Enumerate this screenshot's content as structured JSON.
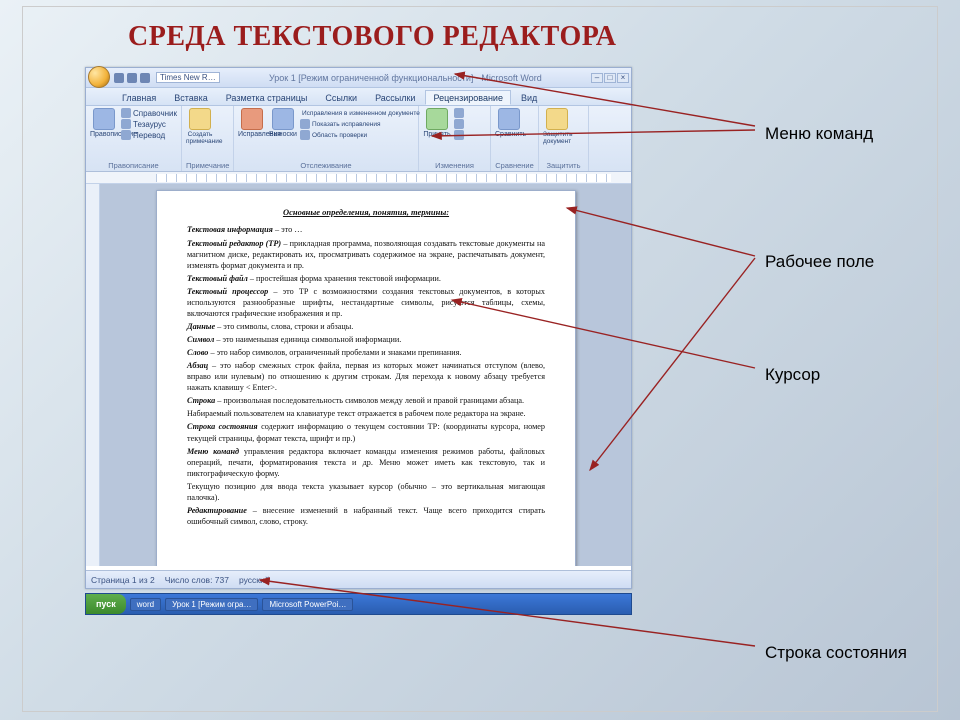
{
  "slide_title": "СРЕДА ТЕКСТОВОГО РЕДАКТОРА",
  "callouts": {
    "menu": "Меню команд",
    "workarea": "Рабочее поле",
    "cursor": "Курсор",
    "statusbar": "Строка состояния"
  },
  "word": {
    "qat_font": "Times New R…",
    "doc_title": "Урок 1 [Режим ограниченной функциональности] - Microsoft Word",
    "tabs": [
      "Главная",
      "Вставка",
      "Разметка страницы",
      "Ссылки",
      "Рассылки",
      "Рецензирование",
      "Вид"
    ],
    "active_tab_index": 5,
    "ribbon_groups": [
      {
        "label": "Правописание",
        "items": [
          "Правописание",
          "Справочник",
          "Тезаурус",
          "Перевод"
        ]
      },
      {
        "label": "Примечание",
        "items": [
          "Создать примечание"
        ]
      },
      {
        "label": "Отслеживание",
        "items": [
          "Исправления",
          "Выноски",
          "Исправления в измененном документе",
          "Показать исправления",
          "Область проверки"
        ]
      },
      {
        "label": "Изменения",
        "items": [
          "Принять",
          "Отклонить"
        ]
      },
      {
        "label": "Сравнение",
        "items": [
          "Сравнить"
        ]
      },
      {
        "label": "Защитить",
        "items": [
          "Защитить документ"
        ]
      }
    ],
    "page": {
      "heading": "Основные определения, понятия, термины:",
      "paragraphs": [
        {
          "b": "Текстовая информация",
          "rest": " – это …"
        },
        {
          "b": "Текстовый редактор (ТР)",
          "rest": " – прикладная программа, позволяющая создавать текстовые документы на магнитном диске, редактировать их, просматривать содержимое на экране, распечатывать документ, изменять формат документа и пр."
        },
        {
          "b": "Текстовый файл",
          "rest": " – простейшая форма хранения текстовой информации."
        },
        {
          "b": "Текстовый процессор",
          "rest": " – это ТР с возможностями создания текстовых документов, в которых используются разнообразные шрифты, нестандартные символы, рисуются таблицы, схемы, включаются графические изображения и пр."
        },
        {
          "b": "Данные",
          "rest": " – это символы, слова, строки и абзацы."
        },
        {
          "b": "Символ",
          "rest": " – это наименьшая единица символьной информации."
        },
        {
          "b": "Слово",
          "rest": " – это набор символов, ограниченный пробелами и знаками препинания."
        },
        {
          "b": "Абзац",
          "rest": " – это набор смежных строк файла, первая из которых может начинаться отступом (влево, вправо или нулевым) по отношению к другим строкам. Для перехода к новому абзацу требуется нажать клавишу < Enter>."
        },
        {
          "b": "Строка",
          "rest": " – произвольная последовательность символов между левой и правой границами абзаца."
        },
        {
          "b": "",
          "rest": "Набираемый пользователем на клавиатуре текст отражается в рабочем поле редактора на экране."
        },
        {
          "b": "Строка состояния",
          "rest": " содержит информацию о текущем состоянии ТР: (координаты курсора, номер текущей страницы, формат текста, шрифт и пр.)"
        },
        {
          "b": "Меню команд",
          "rest": " управления редактора включает команды изменения режимов работы, файловых операций, печати, форматирования текста и др. Меню может иметь как текстовую, так и пиктографическую форму."
        },
        {
          "b": "",
          "rest": "Текущую позицию для ввода текста указывает курсор (обычно – это вертикальная мигающая палочка)."
        },
        {
          "b": "Редактирование",
          "rest": " – внесение изменений в набранный текст. Чаще всего приходится стирать ошибочный символ, слово, строку."
        }
      ]
    },
    "status": {
      "page": "Страница 1 из 2",
      "words": "Число слов: 737",
      "lang": "русский"
    }
  },
  "taskbar": {
    "start": "пуск",
    "items": [
      "word",
      "Урок 1 [Режим огра…",
      "Microsoft PowerPoi…"
    ]
  }
}
